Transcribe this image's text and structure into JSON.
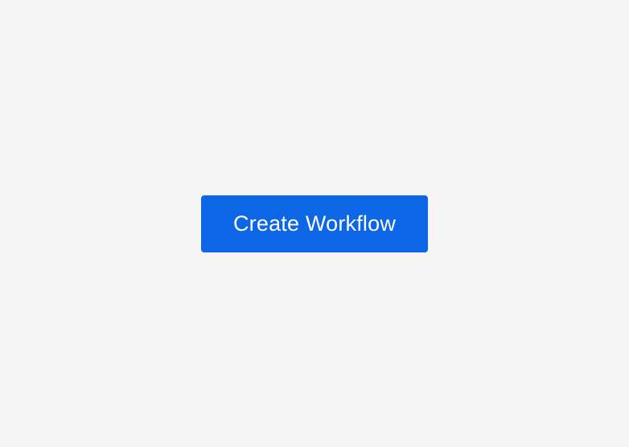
{
  "button": {
    "label": "Create Workflow"
  }
}
